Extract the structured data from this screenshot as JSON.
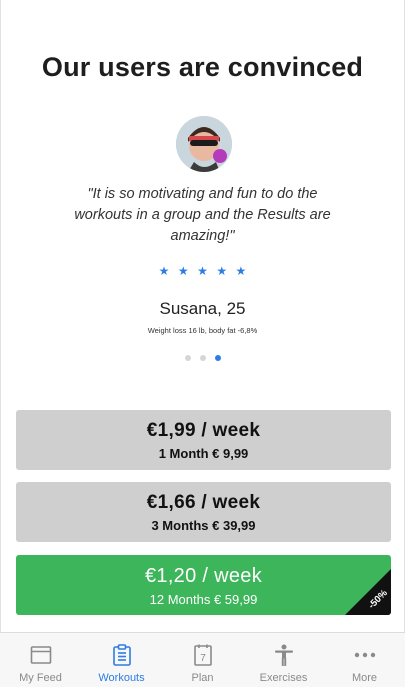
{
  "header": {
    "title": "Our users are convinced"
  },
  "testimonial": {
    "quote": "\"It is so motivating and fun to do the workouts in a group and the Results are amazing!\"",
    "rating": 5,
    "name": "Susana, 25",
    "stats": "Weight loss 16 lb, body fat -6,8%",
    "pager": {
      "count": 3,
      "active_index": 2
    }
  },
  "plans": [
    {
      "price": "€1,99 / week",
      "detail": "1 Month € 9,99"
    },
    {
      "price": "€1,66 / week",
      "detail": "3 Months € 39,99"
    },
    {
      "price": "€1,20 / week",
      "detail": "12 Months € 59,99",
      "badge": "-50%"
    }
  ],
  "tabbar": {
    "items": [
      {
        "label": "My Feed",
        "icon": "feed-icon"
      },
      {
        "label": "Workouts",
        "icon": "clipboard-icon",
        "active": true
      },
      {
        "label": "Plan",
        "icon": "calendar-icon",
        "calendar_day": "7"
      },
      {
        "label": "Exercises",
        "icon": "person-icon"
      },
      {
        "label": "More",
        "icon": "more-dots-icon"
      }
    ]
  },
  "colors": {
    "accent": "#2d7de2",
    "highlight_plan": "#3cb55b",
    "plan_grey": "#cfcfcf"
  }
}
